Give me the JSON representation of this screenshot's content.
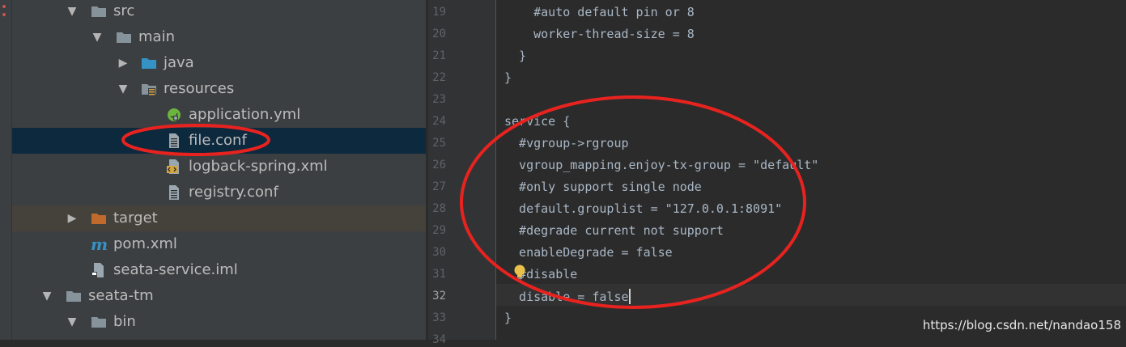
{
  "project_tree": {
    "items": [
      {
        "label": "src",
        "expanded": true,
        "icon": "folder-icon"
      },
      {
        "label": "main",
        "expanded": true,
        "icon": "folder-icon"
      },
      {
        "label": "java",
        "expanded": false,
        "icon": "source-folder-icon"
      },
      {
        "label": "resources",
        "expanded": true,
        "icon": "resources-folder-icon"
      },
      {
        "label": "application.yml",
        "icon": "spring-yml-icon"
      },
      {
        "label": "file.conf",
        "icon": "text-file-icon",
        "selected": true
      },
      {
        "label": "logback-spring.xml",
        "icon": "xml-file-icon"
      },
      {
        "label": "registry.conf",
        "icon": "text-file-icon"
      },
      {
        "label": "target",
        "expanded": false,
        "icon": "excluded-folder-icon"
      },
      {
        "label": "pom.xml",
        "icon": "maven-icon"
      },
      {
        "label": "seata-service.iml",
        "icon": "iml-file-icon"
      },
      {
        "label": "seata-tm",
        "expanded": true,
        "icon": "folder-icon"
      },
      {
        "label": "bin",
        "expanded": true,
        "icon": "folder-icon"
      }
    ]
  },
  "editor": {
    "lines": [
      {
        "num": "19",
        "text": "    #auto default pin or 8"
      },
      {
        "num": "20",
        "text": "    worker-thread-size = 8"
      },
      {
        "num": "21",
        "text": "  }"
      },
      {
        "num": "22",
        "text": "}"
      },
      {
        "num": "23",
        "text": ""
      },
      {
        "num": "24",
        "text": "service {"
      },
      {
        "num": "25",
        "text": "  #vgroup->rgroup"
      },
      {
        "num": "26",
        "text": "  vgroup_mapping.enjoy-tx-group = \"default\""
      },
      {
        "num": "27",
        "text": "  #only support single node"
      },
      {
        "num": "28",
        "text": "  default.grouplist = \"127.0.0.1:8091\""
      },
      {
        "num": "29",
        "text": "  #degrade current not support"
      },
      {
        "num": "30",
        "text": "  enableDegrade = false"
      },
      {
        "num": "31",
        "text": "  #disable"
      },
      {
        "num": "32",
        "text": "  disable = false"
      },
      {
        "num": "33",
        "text": "}"
      },
      {
        "num": "34",
        "text": ""
      }
    ],
    "current_line": "32"
  },
  "watermark": "https://blog.csdn.net/nandao158",
  "colors": {
    "tree_bg": "#3c3f41",
    "editor_bg": "#2b2b2b",
    "selection": "#0d293e",
    "annotation": "#e8231f",
    "text": "#a9b7c6"
  }
}
